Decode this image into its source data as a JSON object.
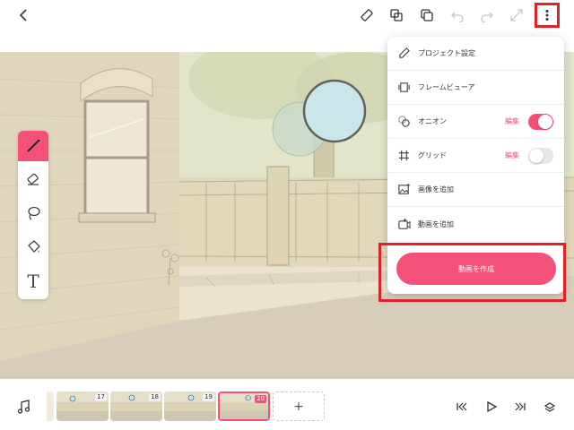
{
  "toolbar": {
    "icons": [
      "back-icon",
      "ruler-icon",
      "copy-layer-icon",
      "duplicate-icon",
      "undo-icon",
      "redo-icon",
      "expand-icon",
      "more-options-icon"
    ]
  },
  "tools": [
    "pen-icon",
    "eraser-icon",
    "lasso-icon",
    "fill-bucket-icon",
    "text-icon"
  ],
  "menu": {
    "items": [
      {
        "label": "プロジェクト設定",
        "icon": "pencil-icon"
      },
      {
        "label": "フレームビューア",
        "icon": "frame-viewer-icon"
      },
      {
        "label": "オニオン",
        "icon": "onion-icon",
        "edit": "編集",
        "toggle": "on"
      },
      {
        "label": "グリッド",
        "icon": "grid-icon",
        "edit": "編集",
        "toggle": "off"
      },
      {
        "label": "画像を追加",
        "icon": "add-image-icon"
      },
      {
        "label": "動画を追加",
        "icon": "add-video-icon"
      }
    ],
    "create_button": "動画を作成"
  },
  "timeline": {
    "frames": [
      "17",
      "18",
      "19",
      "20"
    ],
    "selected_frame": "20",
    "add_label": "+"
  },
  "colors": {
    "accent": "#f4507a",
    "highlight": "#e0202a"
  }
}
